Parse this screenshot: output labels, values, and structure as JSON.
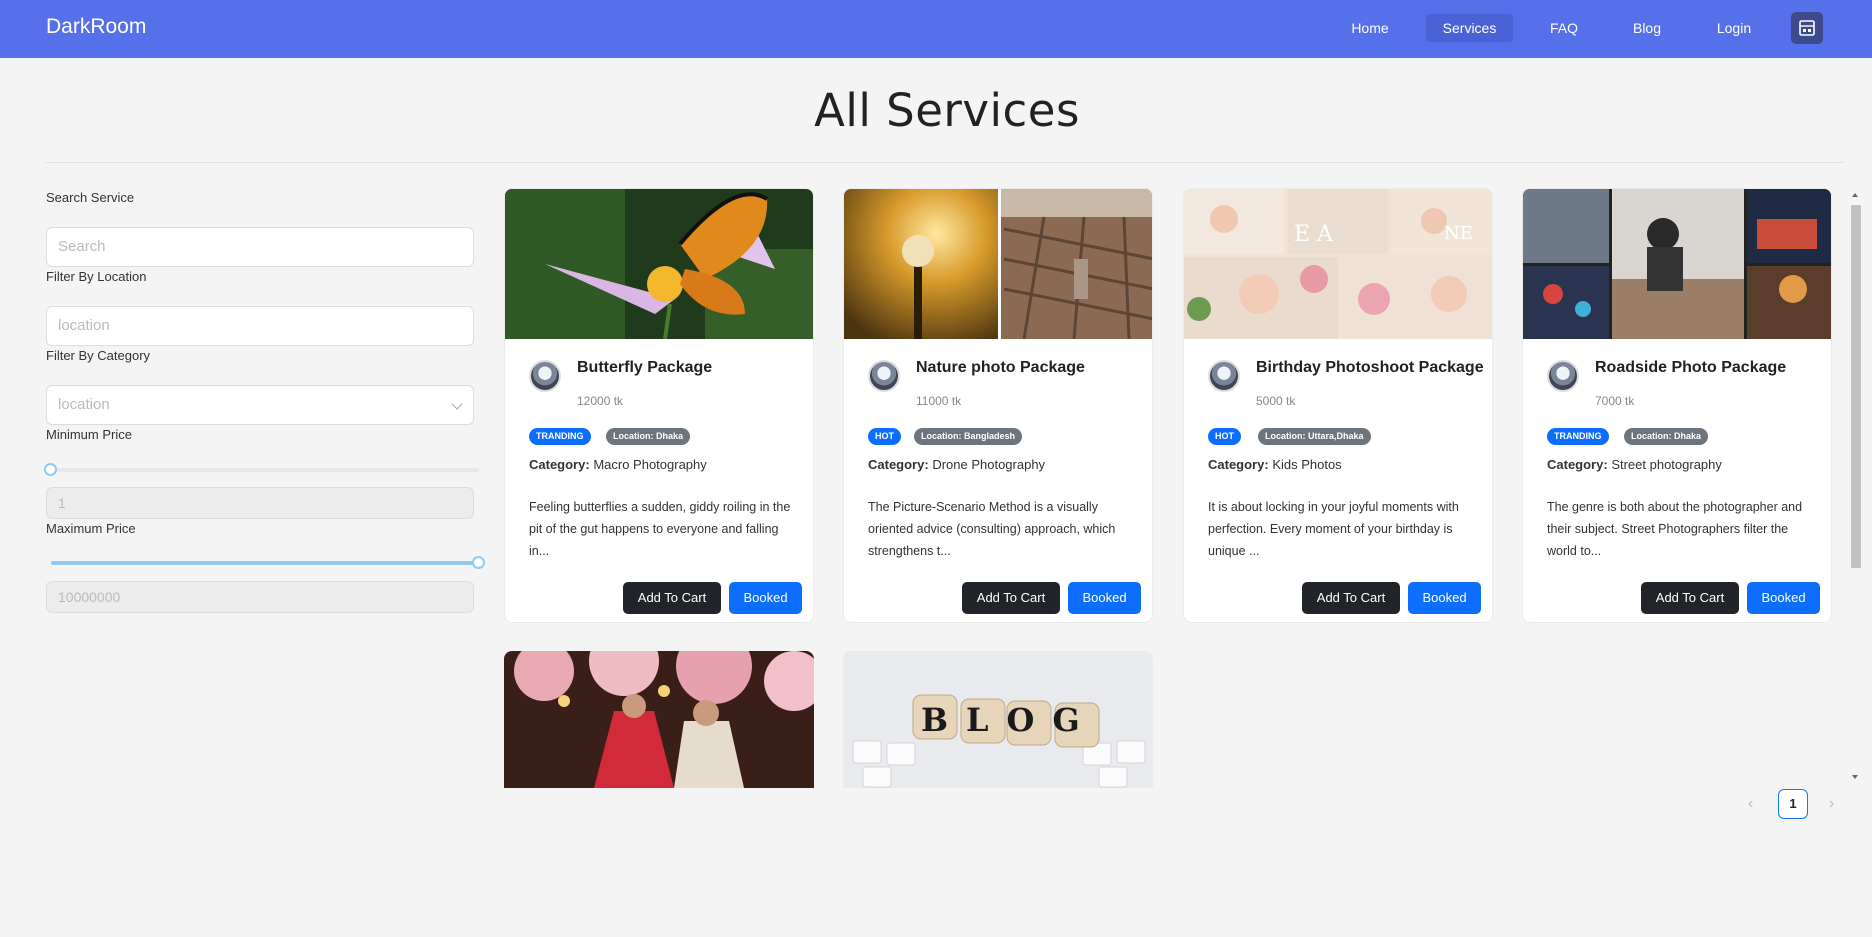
{
  "navbar": {
    "brand": "DarkRoom",
    "items": [
      {
        "label": "Home"
      },
      {
        "label": "Services"
      },
      {
        "label": "FAQ"
      },
      {
        "label": "Blog"
      },
      {
        "label": "Login"
      }
    ],
    "active": "Services",
    "colors": {
      "bar": "#5570e8",
      "active": "#4a62d6",
      "cart": "#3d4a8c"
    }
  },
  "page_title": "All Services",
  "sidebar": {
    "search_label": "Search Service",
    "search_placeholder": "Search",
    "location_label": "Filter By Location",
    "location_placeholder": "location",
    "category_label": "Filter By Category",
    "category_placeholder": "location",
    "min_price_label": "Minimum Price",
    "min_price_value": "1",
    "max_price_label": "Maximum Price",
    "max_price_value": "10000000"
  },
  "cards": [
    {
      "title": "Butterfly Package",
      "price": "12000 tk",
      "badge": "TRANDING",
      "location": "Location: Dhaka",
      "category_label": "Category:",
      "category": "Macro Photography",
      "description": "Feeling butterflies a sudden, giddy roiling in the pit of the gut happens to everyone and falling in...",
      "cart_label": "Add To Cart",
      "booked_label": "Booked"
    },
    {
      "title": "Nature photo Package",
      "price": "11000 tk",
      "badge": "HOT",
      "location": "Location: Bangladesh",
      "category_label": "Category:",
      "category": "Drone Photography",
      "description": "The Picture-Scenario Method is a visually oriented advice (consulting) approach, which strengthens t...",
      "cart_label": "Add To Cart",
      "booked_label": "Booked"
    },
    {
      "title": "Birthday Photoshoot Package",
      "price": "5000 tk",
      "badge": "HOT",
      "location": "Location: Uttara,Dhaka",
      "category_label": "Category:",
      "category": "Kids Photos",
      "description": "It is about locking in your joyful moments with perfection. Every moment of your birthday is unique ...",
      "cart_label": "Add To Cart",
      "booked_label": "Booked"
    },
    {
      "title": "Roadside Photo Package",
      "price": "7000 tk",
      "badge": "TRANDING",
      "location": "Location: Dhaka",
      "category_label": "Category:",
      "category": "Street photography",
      "description": "The genre is both about the photographer and their subject. Street Photographers filter the world to...",
      "cart_label": "Add To Cart",
      "booked_label": "Booked"
    }
  ],
  "blog_image_text": "BLOG",
  "pagination": {
    "current": "1",
    "prev": "‹",
    "next": "›"
  }
}
